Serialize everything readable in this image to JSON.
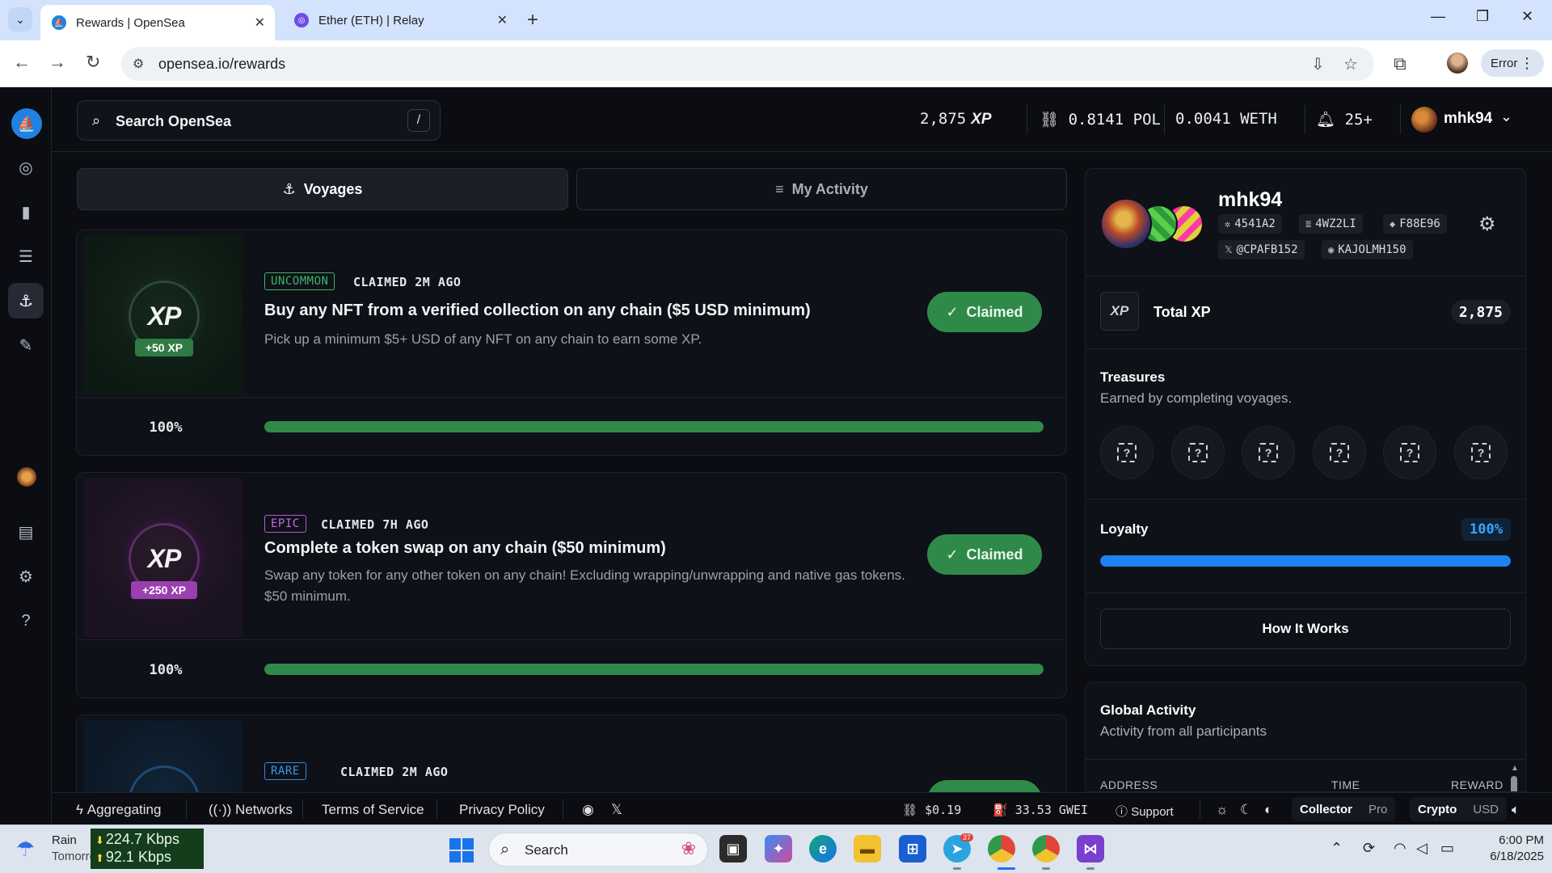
{
  "browser": {
    "tabs": [
      {
        "title": "Rewards | OpenSea",
        "active": true
      },
      {
        "title": "Ether (ETH) | Relay",
        "active": false
      }
    ],
    "url": "opensea.io/rewards",
    "profile_button": "Error"
  },
  "header": {
    "search_placeholder": "Search OpenSea",
    "search_shortcut": "/",
    "xp_value": "2,875",
    "xp_mark": "XP",
    "pol_balance": "0.8141 POL",
    "weth_balance": "0.0041 WETH",
    "notifications": "25+",
    "username": "mhk94"
  },
  "tabs": {
    "voyages": "Voyages",
    "my_activity": "My Activity"
  },
  "voyages": [
    {
      "rarity": "UNCOMMON",
      "rarity_color": "#3fb36a",
      "claimed": "CLAIMED 2M AGO",
      "title": "Buy any NFT from a verified collection on any chain ($5 USD minimum)",
      "description": "Pick up a minimum $5+ USD of any NFT on any chain to earn some XP.",
      "xp_badge": "+50 XP",
      "button": "Claimed",
      "progress_label": "100%",
      "progress": 1.0
    },
    {
      "rarity": "EPIC",
      "rarity_color": "#b35ad8",
      "claimed": "CLAIMED 7H AGO",
      "title": "Complete a token swap on any chain ($50 minimum)",
      "description": "Swap any token for any other token on any chain! Excluding wrapping/unwrapping and native gas tokens. $50 minimum.",
      "xp_badge": "+250 XP",
      "button": "Claimed",
      "progress_label": "100%",
      "progress": 1.0
    },
    {
      "rarity": "RARE",
      "rarity_color": "#2f8ae0",
      "claimed": "CLAIMED 2M AGO"
    }
  ],
  "profile": {
    "name": "mhk94",
    "chips": [
      "4541A2",
      "4WZ2LI",
      "F88E96",
      "@CPAFB152",
      "KAJOLMH150"
    ],
    "total_xp_label": "Total XP",
    "total_xp_mark": "XP",
    "total_xp": "2,875",
    "treasures_title": "Treasures",
    "treasures_subtitle": "Earned by completing voyages.",
    "treasure_placeholder": "?",
    "loyalty_label": "Loyalty",
    "loyalty_value": "100%",
    "loyalty_progress": 1.0,
    "how_it_works": "How It Works"
  },
  "global_activity": {
    "title": "Global Activity",
    "subtitle": "Activity from all participants",
    "columns": [
      "ADDRESS",
      "TIME",
      "REWARD"
    ]
  },
  "footer": {
    "aggregating": "Aggregating",
    "networks": "Networks",
    "terms": "Terms of Service",
    "privacy": "Privacy Policy",
    "pol_price": "$0.19",
    "gas": "33.53 GWEI",
    "support": "Support",
    "mode_collector": "Collector",
    "mode_pro": "Pro",
    "currency_crypto": "Crypto",
    "currency_usd": "USD"
  },
  "taskbar": {
    "weather_title": "Rain",
    "weather_sub": "Tomorrow",
    "download": "224.7 Kbps",
    "upload": "92.1 Kbps",
    "search": "Search",
    "time": "6:00 PM",
    "date": "6/18/2025",
    "telegram_badge": "37"
  },
  "colors": {
    "claimed_green": "#2f8a4a",
    "loyalty_blue": "#1c84f0",
    "opensea_blue": "#2081e2"
  }
}
